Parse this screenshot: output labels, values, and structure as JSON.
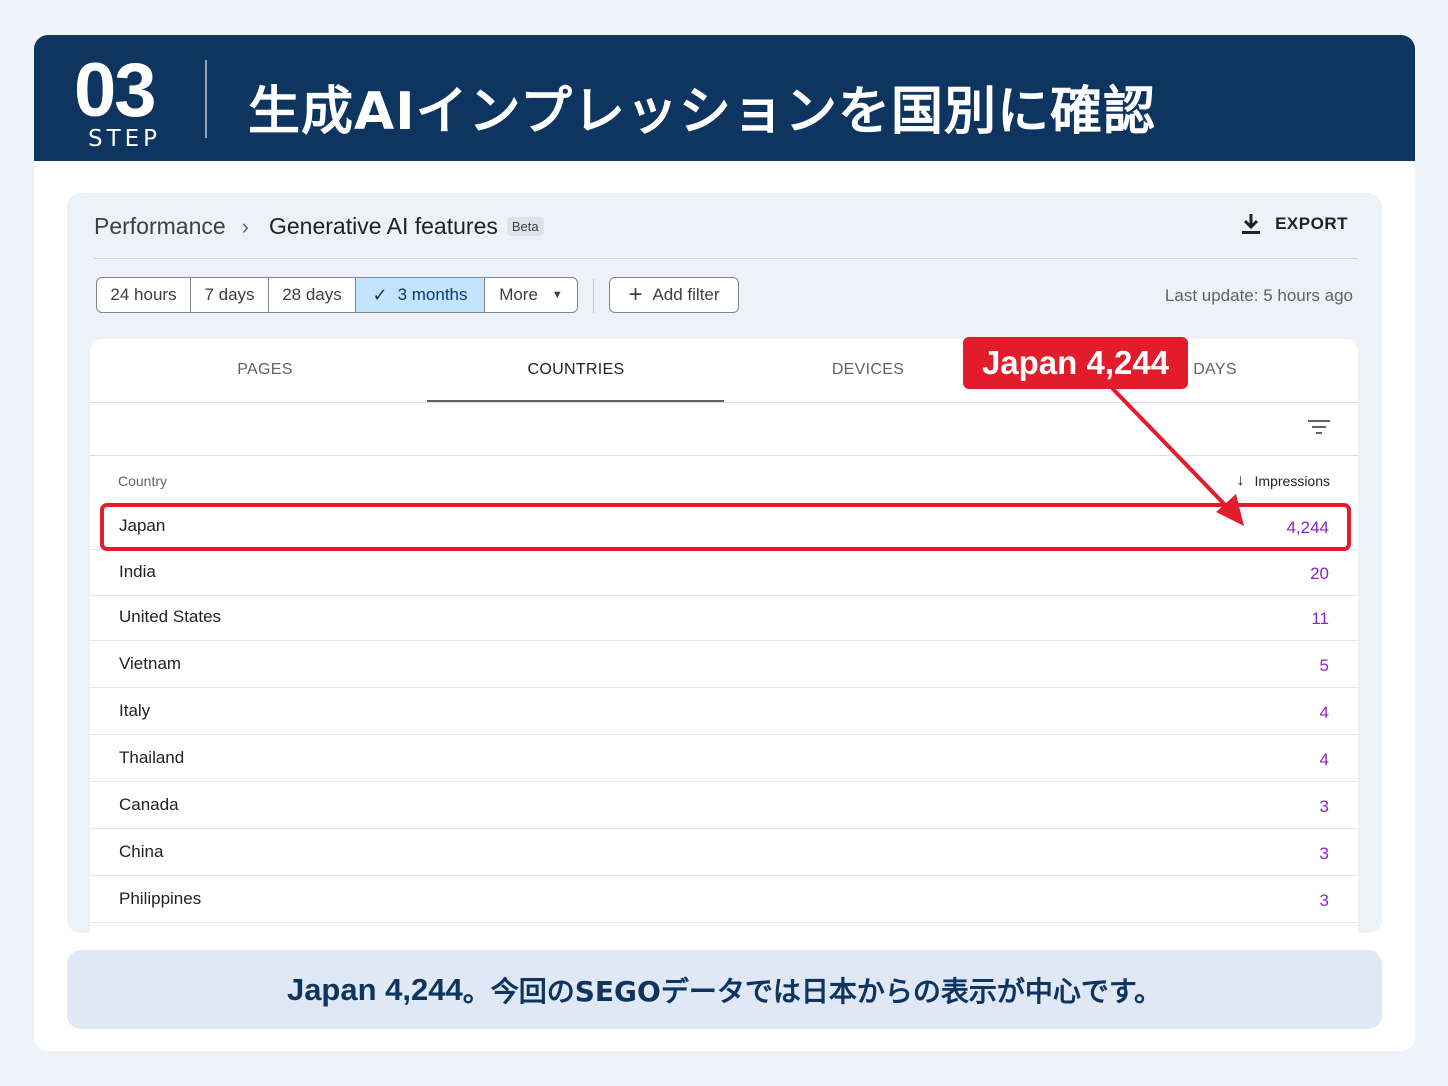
{
  "banner": {
    "step_number": "03",
    "step_label": "STEP",
    "title": "生成AIインプレッションを国別に確認"
  },
  "header": {
    "breadcrumb_root": "Performance",
    "breadcrumb_sep_icon": "chevron-right-icon",
    "page_title": "Generative AI features",
    "badge": "Beta",
    "export_label": "EXPORT",
    "export_icon": "download-icon"
  },
  "date_range": {
    "options": [
      "24 hours",
      "7 days",
      "28 days",
      "3 months",
      "More"
    ],
    "selected": "3 months",
    "add_filter_label": "Add filter",
    "last_update": "Last update: 5 hours ago"
  },
  "tabs": {
    "items": [
      "PAGES",
      "COUNTRIES",
      "DEVICES",
      "DAYS"
    ],
    "active": "COUNTRIES"
  },
  "table": {
    "column_country": "Country",
    "column_impressions": "Impressions",
    "sort": "descending",
    "rows": [
      {
        "country": "Japan",
        "impressions": "4,244"
      },
      {
        "country": "India",
        "impressions": "20"
      },
      {
        "country": "United States",
        "impressions": "11"
      },
      {
        "country": "Vietnam",
        "impressions": "5"
      },
      {
        "country": "Italy",
        "impressions": "4"
      },
      {
        "country": "Thailand",
        "impressions": "4"
      },
      {
        "country": "Canada",
        "impressions": "3"
      },
      {
        "country": "China",
        "impressions": "3"
      },
      {
        "country": "Philippines",
        "impressions": "3"
      }
    ]
  },
  "annotation": {
    "callout": "Japan 4,244",
    "color": "#e31c2b"
  },
  "footer": {
    "lead": "Japan 4,244",
    "text": "。今回のSEGOデータでは日本からの表示が中心です。"
  },
  "colors": {
    "banner": "#0e3460",
    "impressions": "#8a26c8",
    "selected_chip": "#c2e4ff"
  }
}
